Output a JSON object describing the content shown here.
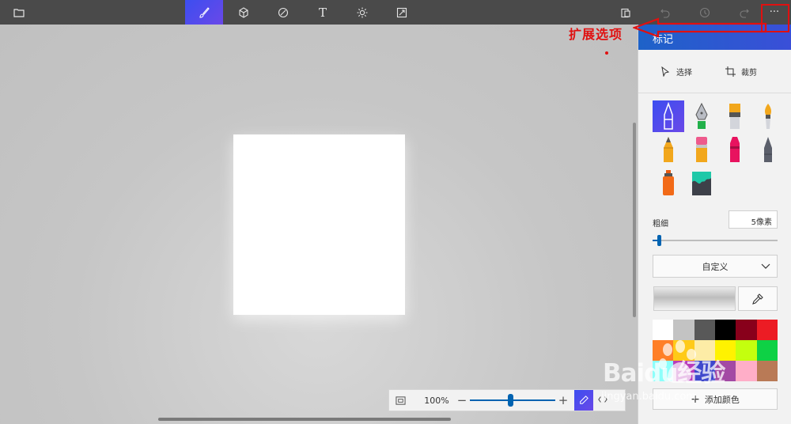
{
  "toolbar": {
    "buttons": [
      {
        "name": "menu",
        "icon": "folder-icon"
      },
      {
        "name": "brushes",
        "icon": "brush-icon",
        "active": true
      },
      {
        "name": "3d-shapes",
        "icon": "cube-icon"
      },
      {
        "name": "stickers",
        "icon": "sticker-icon"
      },
      {
        "name": "text",
        "icon": "text-icon",
        "glyph": "T"
      },
      {
        "name": "effects",
        "icon": "sun-icon"
      },
      {
        "name": "canvas",
        "icon": "canvas-icon"
      },
      {
        "name": "paste",
        "icon": "paste-icon"
      },
      {
        "name": "undo",
        "icon": "undo-icon"
      },
      {
        "name": "history",
        "icon": "history-icon"
      },
      {
        "name": "redo",
        "icon": "redo-icon"
      },
      {
        "name": "more",
        "icon": "more-icon",
        "glyph": "···"
      }
    ]
  },
  "annotation": {
    "label": "扩展选项",
    "color": "#e01010"
  },
  "panel": {
    "title": "标记",
    "select_label": "选择",
    "crop_label": "裁剪",
    "thickness_label": "粗细",
    "thickness_value": "5像素",
    "thickness_fraction": 0.05,
    "dropdown_value": "自定义",
    "add_color_label": "添加颜色",
    "palette": [
      "#ffffff",
      "#c3c3c3",
      "#585858",
      "#000000",
      "#88001b",
      "#ec1c24",
      "#ff7f27",
      "#ffca18",
      "#fdeca6",
      "#fff200",
      "#c4ff0e",
      "#0ed145",
      "#8cfffb",
      "#b83dba",
      "#3f48cc",
      "#a349a4",
      "#ffaec8",
      "#b97a56"
    ],
    "brushes": [
      "marker-icon",
      "calligraphy-pen-icon",
      "oil-brush-icon",
      "watercolor-icon",
      "pencil-icon",
      "eraser-icon",
      "crayon-icon",
      "pixel-pen-icon",
      "spray-can-icon",
      "fill-bucket-icon"
    ]
  },
  "zoom": {
    "percent": "100%",
    "minus": "−",
    "plus": "+",
    "level_fraction": 0.48
  },
  "watermark": {
    "text": "Baidu经验",
    "sub": "jingyan.baidu.com"
  }
}
